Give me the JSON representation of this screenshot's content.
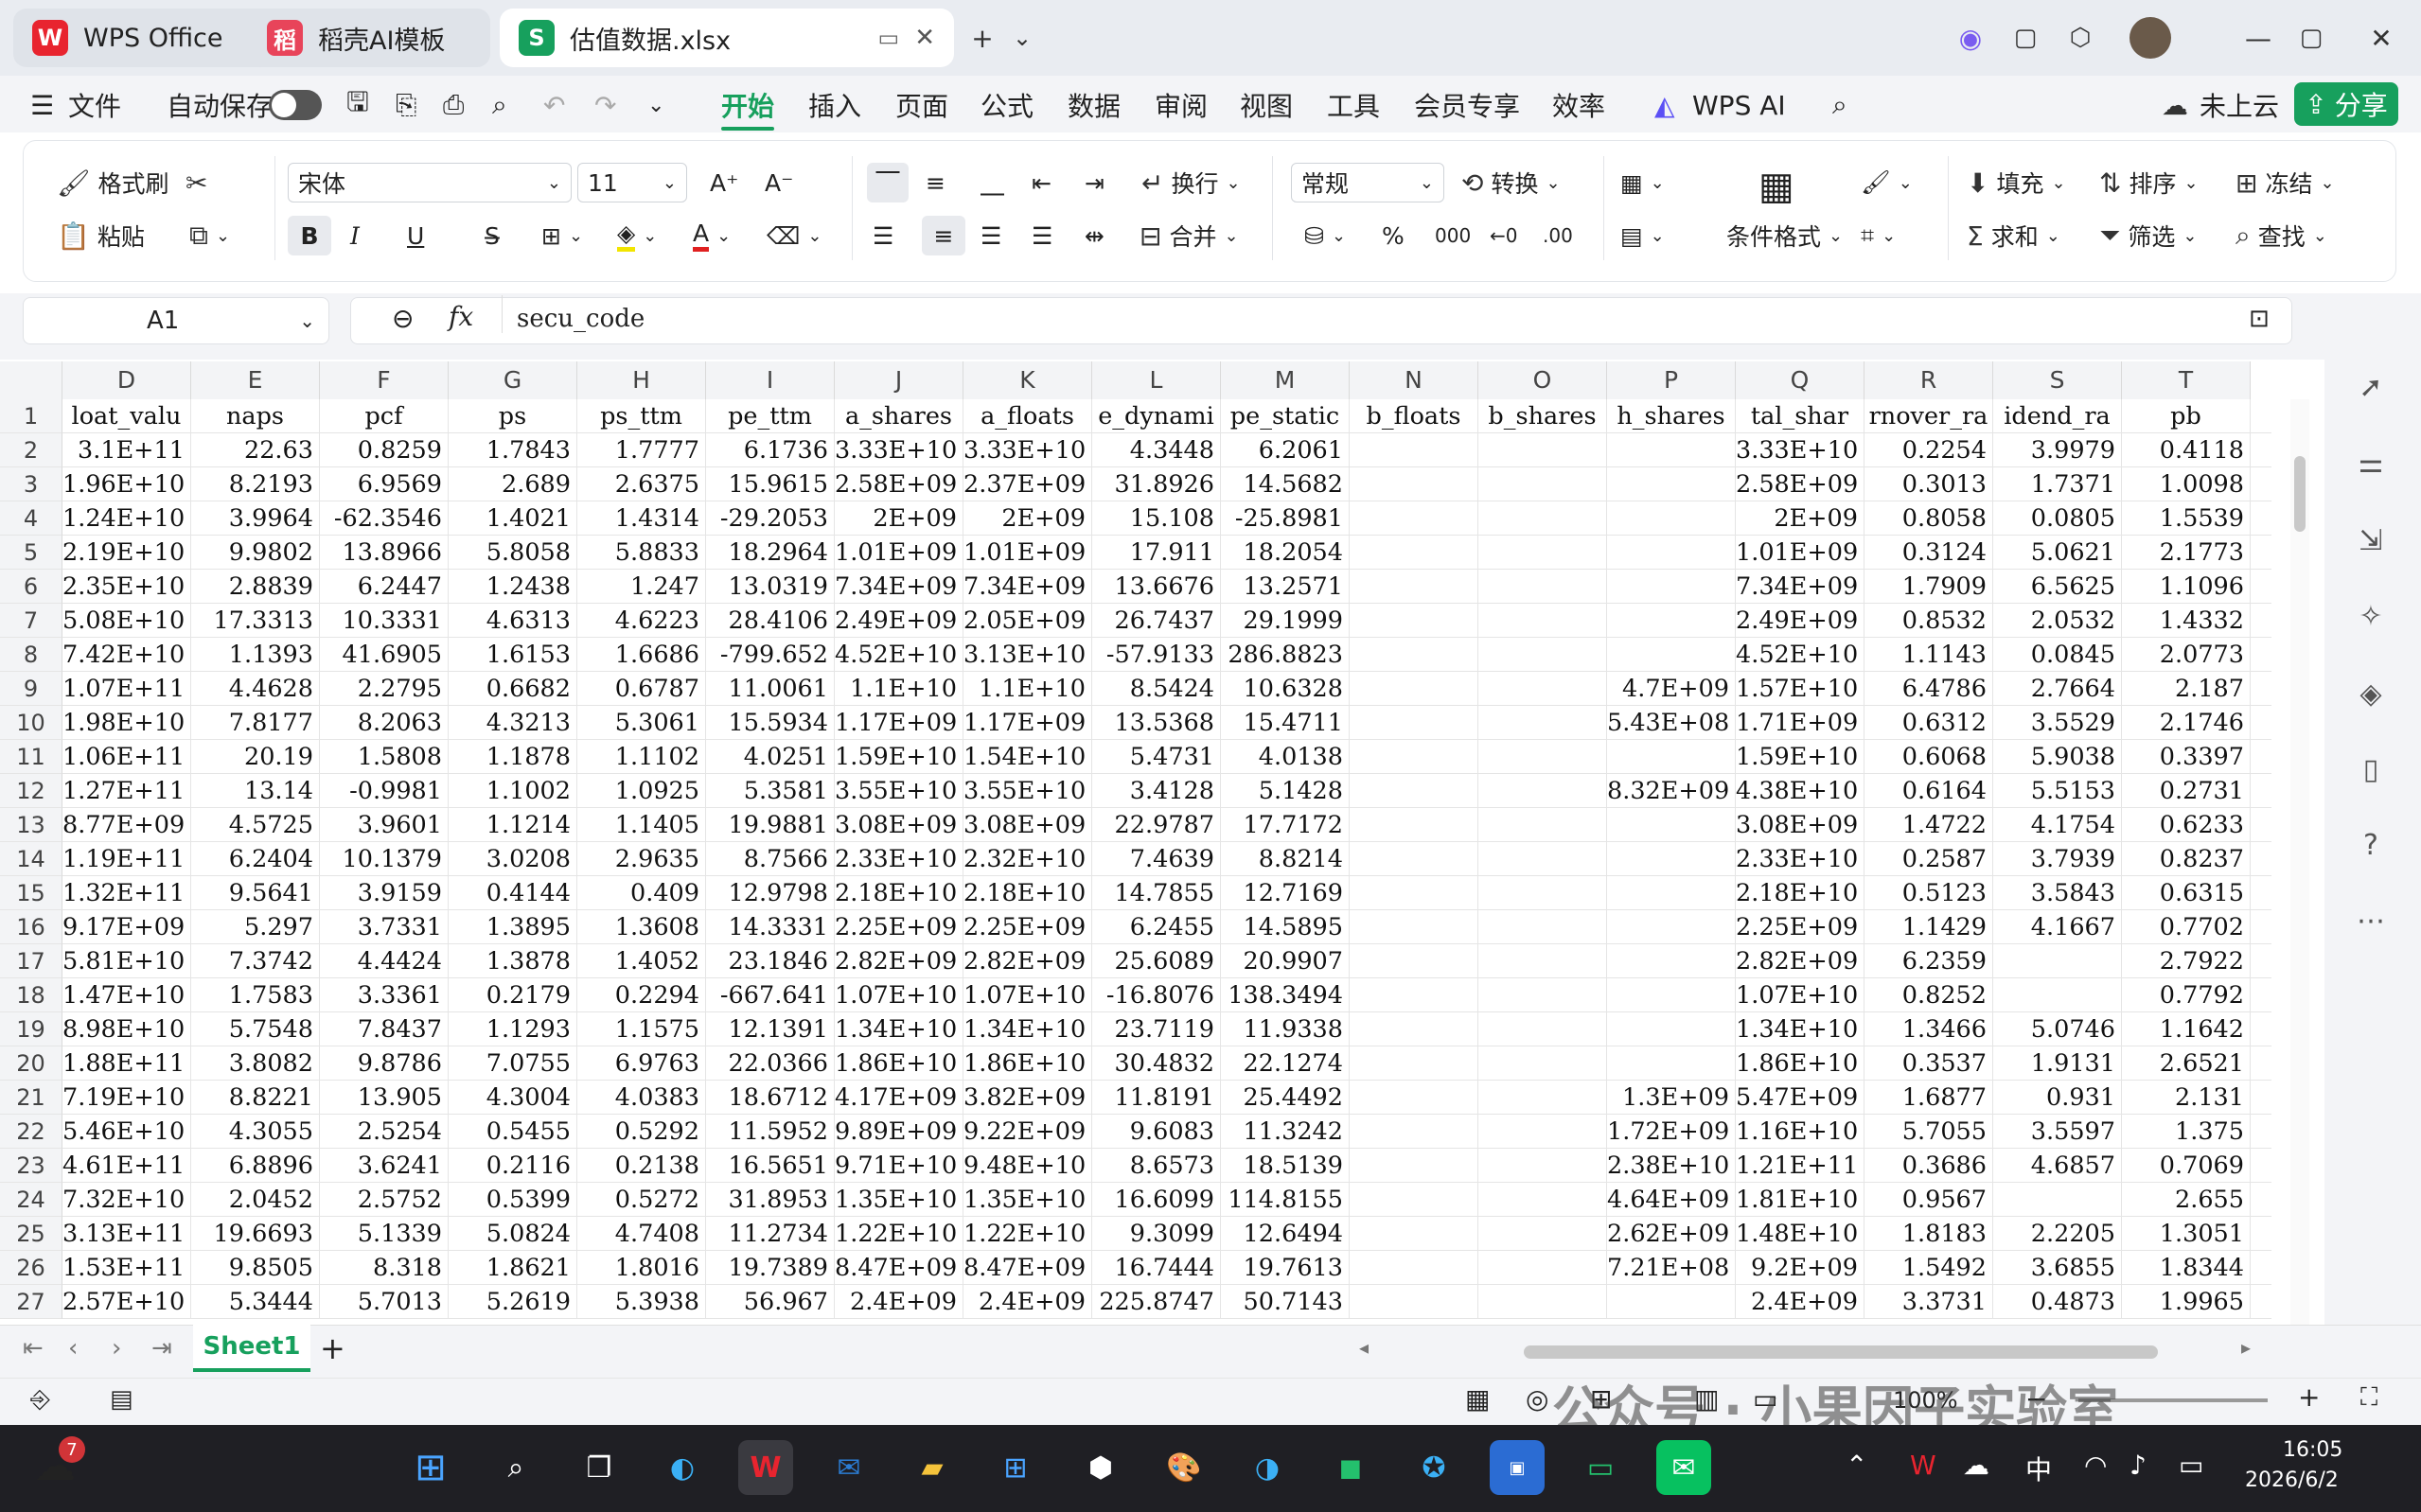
{
  "titlebar": {
    "tabs": [
      {
        "label": "WPS Office",
        "logo": "W"
      },
      {
        "label": "稻壳AI模板",
        "logo": "稻"
      },
      {
        "label": "估值数据.xlsx",
        "logo": "S"
      }
    ],
    "new_tab": "+",
    "chevron": "⌄"
  },
  "menu": {
    "file": "文件",
    "autosave": "自动保存",
    "items": [
      "开始",
      "插入",
      "页面",
      "公式",
      "数据",
      "审阅",
      "视图",
      "工具",
      "会员专享",
      "效率"
    ],
    "wps_ai": "WPS AI",
    "cloud": "未上云",
    "share": "分享"
  },
  "ribbon": {
    "format_painter": "格式刷",
    "paste": "粘贴",
    "font": "宋体",
    "font_size": "11",
    "wrap": "换行",
    "merge": "合并",
    "number_format": "常规",
    "convert": "转换",
    "percent": "%",
    "thousands": "000",
    "cond_format": "条件格式",
    "fill": "填充",
    "sort": "排序",
    "freeze": "冻结",
    "sum": "求和",
    "filter": "筛选",
    "find": "查找",
    "bold": "B",
    "italic": "I",
    "underline": "U"
  },
  "formula": {
    "cell_ref": "A1",
    "fx": "fx",
    "value": "secu_code"
  },
  "grid": {
    "columns": [
      "D",
      "E",
      "F",
      "G",
      "H",
      "I",
      "J",
      "K",
      "L",
      "M",
      "N",
      "O",
      "P",
      "Q",
      "R",
      "S",
      "T"
    ],
    "header_row": [
      "loat_valu",
      "naps",
      "pcf",
      "ps",
      "ps_ttm",
      "pe_ttm",
      "a_shares",
      "a_floats",
      "e_dynami",
      "pe_static",
      "b_floats",
      "b_shares",
      "h_shares",
      "tal_shar",
      "rnover_ra",
      "idend_ra",
      "pb"
    ],
    "rows": [
      [
        "2",
        "3.1E+11",
        "22.63",
        "0.8259",
        "1.7843",
        "1.7777",
        "6.1736",
        "3.33E+10",
        "3.33E+10",
        "4.3448",
        "6.2061",
        "",
        "",
        "",
        "3.33E+10",
        "0.2254",
        "3.9979",
        "0.4118"
      ],
      [
        "3",
        "1.96E+10",
        "8.2193",
        "6.9569",
        "2.689",
        "2.6375",
        "15.9615",
        "2.58E+09",
        "2.37E+09",
        "31.8926",
        "14.5682",
        "",
        "",
        "",
        "2.58E+09",
        "0.3013",
        "1.7371",
        "1.0098"
      ],
      [
        "4",
        "1.24E+10",
        "3.9964",
        "-62.3546",
        "1.4021",
        "1.4314",
        "-29.2053",
        "2E+09",
        "2E+09",
        "15.108",
        "-25.8981",
        "",
        "",
        "",
        "2E+09",
        "0.8058",
        "0.0805",
        "1.5539"
      ],
      [
        "5",
        "2.19E+10",
        "9.9802",
        "13.8966",
        "5.8058",
        "5.8833",
        "18.2964",
        "1.01E+09",
        "1.01E+09",
        "17.911",
        "18.2054",
        "",
        "",
        "",
        "1.01E+09",
        "0.3124",
        "5.0621",
        "2.1773"
      ],
      [
        "6",
        "2.35E+10",
        "2.8839",
        "6.2447",
        "1.2438",
        "1.247",
        "13.0319",
        "7.34E+09",
        "7.34E+09",
        "13.6676",
        "13.2571",
        "",
        "",
        "",
        "7.34E+09",
        "1.7909",
        "6.5625",
        "1.1096"
      ],
      [
        "7",
        "5.08E+10",
        "17.3313",
        "10.3331",
        "4.6313",
        "4.6223",
        "28.4106",
        "2.49E+09",
        "2.05E+09",
        "26.7437",
        "29.1999",
        "",
        "",
        "",
        "2.49E+09",
        "0.8532",
        "2.0532",
        "1.4332"
      ],
      [
        "8",
        "7.42E+10",
        "1.1393",
        "41.6905",
        "1.6153",
        "1.6686",
        "-799.652",
        "4.52E+10",
        "3.13E+10",
        "-57.9133",
        "286.8823",
        "",
        "",
        "",
        "4.52E+10",
        "1.1143",
        "0.0845",
        "2.0773"
      ],
      [
        "9",
        "1.07E+11",
        "4.4628",
        "2.2795",
        "0.6682",
        "0.6787",
        "11.0061",
        "1.1E+10",
        "1.1E+10",
        "8.5424",
        "10.6328",
        "",
        "",
        "4.7E+09",
        "1.57E+10",
        "6.4786",
        "2.7664",
        "2.187"
      ],
      [
        "10",
        "1.98E+10",
        "7.8177",
        "8.2063",
        "4.3213",
        "5.3061",
        "15.5934",
        "1.17E+09",
        "1.17E+09",
        "13.5368",
        "15.4711",
        "",
        "",
        "5.43E+08",
        "1.71E+09",
        "0.6312",
        "3.5529",
        "2.1746"
      ],
      [
        "11",
        "1.06E+11",
        "20.19",
        "1.5808",
        "1.1878",
        "1.1102",
        "4.0251",
        "1.59E+10",
        "1.54E+10",
        "5.4731",
        "4.0138",
        "",
        "",
        "",
        "1.59E+10",
        "0.6068",
        "5.9038",
        "0.3397"
      ],
      [
        "12",
        "1.27E+11",
        "13.14",
        "-0.9981",
        "1.1002",
        "1.0925",
        "5.3581",
        "3.55E+10",
        "3.55E+10",
        "3.4128",
        "5.1428",
        "",
        "",
        "8.32E+09",
        "4.38E+10",
        "0.6164",
        "5.5153",
        "0.2731"
      ],
      [
        "13",
        "8.77E+09",
        "4.5725",
        "3.9601",
        "1.1214",
        "1.1405",
        "19.9881",
        "3.08E+09",
        "3.08E+09",
        "22.9787",
        "17.7172",
        "",
        "",
        "",
        "3.08E+09",
        "1.4722",
        "4.1754",
        "0.6233"
      ],
      [
        "14",
        "1.19E+11",
        "6.2404",
        "10.1379",
        "3.0208",
        "2.9635",
        "8.7566",
        "2.33E+10",
        "2.32E+10",
        "7.4639",
        "8.8214",
        "",
        "",
        "",
        "2.33E+10",
        "0.2587",
        "3.7939",
        "0.8237"
      ],
      [
        "15",
        "1.32E+11",
        "9.5641",
        "3.9159",
        "0.4144",
        "0.409",
        "12.9798",
        "2.18E+10",
        "2.18E+10",
        "14.7855",
        "12.7169",
        "",
        "",
        "",
        "2.18E+10",
        "0.5123",
        "3.5843",
        "0.6315"
      ],
      [
        "16",
        "9.17E+09",
        "5.297",
        "3.7331",
        "1.3895",
        "1.3608",
        "14.3331",
        "2.25E+09",
        "2.25E+09",
        "6.2455",
        "14.5895",
        "",
        "",
        "",
        "2.25E+09",
        "1.1429",
        "4.1667",
        "0.7702"
      ],
      [
        "17",
        "5.81E+10",
        "7.3742",
        "4.4424",
        "1.3878",
        "1.4052",
        "23.1846",
        "2.82E+09",
        "2.82E+09",
        "25.6089",
        "20.9907",
        "",
        "",
        "",
        "2.82E+09",
        "6.2359",
        "",
        "2.7922"
      ],
      [
        "18",
        "1.47E+10",
        "1.7583",
        "3.3361",
        "0.2179",
        "0.2294",
        "-667.641",
        "1.07E+10",
        "1.07E+10",
        "-16.8076",
        "138.3494",
        "",
        "",
        "",
        "1.07E+10",
        "0.8252",
        "",
        "0.7792"
      ],
      [
        "19",
        "8.98E+10",
        "5.7548",
        "7.8437",
        "1.1293",
        "1.1575",
        "12.1391",
        "1.34E+10",
        "1.34E+10",
        "23.7119",
        "11.9338",
        "",
        "",
        "",
        "1.34E+10",
        "1.3466",
        "5.0746",
        "1.1642"
      ],
      [
        "20",
        "1.88E+11",
        "3.8082",
        "9.8786",
        "7.0755",
        "6.9763",
        "22.0366",
        "1.86E+10",
        "1.86E+10",
        "30.4832",
        "22.1274",
        "",
        "",
        "",
        "1.86E+10",
        "0.3537",
        "1.9131",
        "2.6521"
      ],
      [
        "21",
        "7.19E+10",
        "8.8221",
        "13.905",
        "4.3004",
        "4.0383",
        "18.6712",
        "4.17E+09",
        "3.82E+09",
        "11.8191",
        "25.4492",
        "",
        "",
        "1.3E+09",
        "5.47E+09",
        "1.6877",
        "0.931",
        "2.131"
      ],
      [
        "22",
        "5.46E+10",
        "4.3055",
        "2.5254",
        "0.5455",
        "0.5292",
        "11.5952",
        "9.89E+09",
        "9.22E+09",
        "9.6083",
        "11.3242",
        "",
        "",
        "1.72E+09",
        "1.16E+10",
        "5.7055",
        "3.5597",
        "1.375"
      ],
      [
        "23",
        "4.61E+11",
        "6.8896",
        "3.6241",
        "0.2116",
        "0.2138",
        "16.5651",
        "9.71E+10",
        "9.48E+10",
        "8.6573",
        "18.5139",
        "",
        "",
        "2.38E+10",
        "1.21E+11",
        "0.3686",
        "4.6857",
        "0.7069"
      ],
      [
        "24",
        "7.32E+10",
        "2.0452",
        "2.5752",
        "0.5399",
        "0.5272",
        "31.8953",
        "1.35E+10",
        "1.35E+10",
        "16.6099",
        "114.8155",
        "",
        "",
        "4.64E+09",
        "1.81E+10",
        "0.9567",
        "",
        "2.655"
      ],
      [
        "25",
        "3.13E+11",
        "19.6693",
        "5.1339",
        "5.0824",
        "4.7408",
        "11.2734",
        "1.22E+10",
        "1.22E+10",
        "9.3099",
        "12.6494",
        "",
        "",
        "2.62E+09",
        "1.48E+10",
        "1.8183",
        "2.2205",
        "1.3051"
      ],
      [
        "26",
        "1.53E+11",
        "9.8505",
        "8.318",
        "1.8621",
        "1.8016",
        "19.7389",
        "8.47E+09",
        "8.47E+09",
        "16.7444",
        "19.7613",
        "",
        "",
        "7.21E+08",
        "9.2E+09",
        "1.5492",
        "3.6855",
        "1.8344"
      ],
      [
        "27",
        "2.57E+10",
        "5.3444",
        "5.7013",
        "5.2619",
        "5.3938",
        "56.967",
        "2.4E+09",
        "2.4E+09",
        "225.8747",
        "50.7143",
        "",
        "",
        "",
        "2.4E+09",
        "3.3731",
        "0.4873",
        "1.9965"
      ]
    ]
  },
  "sheet_tabs": {
    "active": "Sheet1",
    "add": "+"
  },
  "statusbar": {
    "zoom": "100%",
    "watermark": "公众号 · 小果因子实验室"
  },
  "taskbar": {
    "time": "16:05",
    "date": "2026/6/2",
    "ime": "中",
    "badge": "7"
  }
}
